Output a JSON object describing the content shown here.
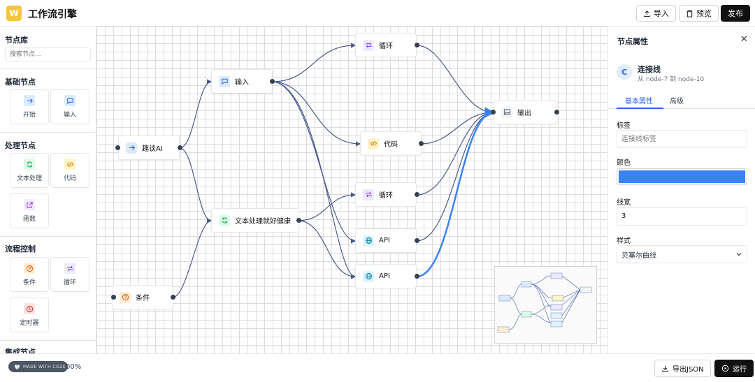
{
  "app": {
    "logo_letter": "W",
    "title": "工作流引擎"
  },
  "header": {
    "import_label": "导入",
    "preview_label": "预览",
    "publish_label": "发布"
  },
  "sidebar": {
    "title": "节点库",
    "search_placeholder": "搜索节点...",
    "categories": [
      {
        "title": "基础节点",
        "items": [
          {
            "label": "开始",
            "icon": "arrow-right-icon"
          },
          {
            "label": "输入",
            "icon": "message-icon"
          }
        ]
      },
      {
        "title": "处理节点",
        "items": [
          {
            "label": "文本处理",
            "icon": "refresh-icon"
          },
          {
            "label": "代码",
            "icon": "code-icon"
          },
          {
            "label": "函数",
            "icon": "external-link-icon"
          }
        ]
      },
      {
        "title": "流程控制",
        "items": [
          {
            "label": "条件",
            "icon": "help-circle-icon"
          },
          {
            "label": "循环",
            "icon": "repeat-icon"
          },
          {
            "label": "定时器",
            "icon": "clock-icon"
          }
        ]
      },
      {
        "title": "集成节点",
        "items": []
      }
    ]
  },
  "canvas": {
    "nodes": [
      {
        "id": "n1",
        "label": "趣谈AI",
        "icon": "arrow-right-icon"
      },
      {
        "id": "n2",
        "label": "条件",
        "icon": "help-circle-icon"
      },
      {
        "id": "n3",
        "label": "输入",
        "icon": "message-icon"
      },
      {
        "id": "n4",
        "label": "文本处理就好健康",
        "icon": "refresh-icon"
      },
      {
        "id": "n5",
        "label": "循环",
        "icon": "repeat-icon"
      },
      {
        "id": "n6",
        "label": "代码",
        "icon": "code-icon"
      },
      {
        "id": "n7",
        "label": "循环",
        "icon": "repeat-icon"
      },
      {
        "id": "n8",
        "label": "API",
        "icon": "globe-icon"
      },
      {
        "id": "n9",
        "label": "API",
        "icon": "globe-icon"
      },
      {
        "id": "n10",
        "label": "输出",
        "icon": "image-icon"
      }
    ],
    "edge_color": "#4a5b8c",
    "selected_edge_color": "#3b82f6"
  },
  "properties": {
    "title": "节点属性",
    "close_icon": "close-icon",
    "badge_letter": "C",
    "name": "连接线",
    "subtitle": "从 node-7 到 node-10",
    "tabs": [
      "基本属性",
      "高级"
    ],
    "label_field": {
      "label": "标签",
      "placeholder": "连接线标签"
    },
    "color_field": {
      "label": "颜色",
      "value": "#3b82f6"
    },
    "width_field": {
      "label": "线宽",
      "value": "3"
    },
    "style_field": {
      "label": "样式",
      "value": "贝塞尔曲线"
    }
  },
  "footer": {
    "watermark": "MADE WITH COZE",
    "zoom": "00%",
    "export_label": "导出JSON",
    "run_label": "运行"
  }
}
